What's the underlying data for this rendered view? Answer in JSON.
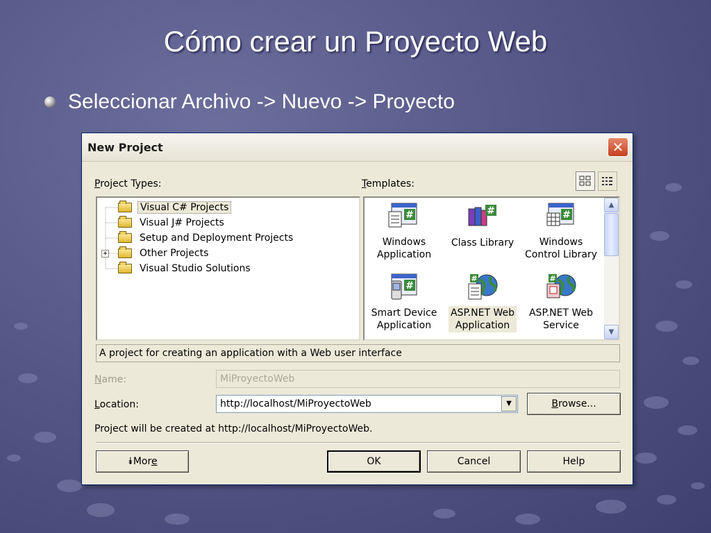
{
  "slide": {
    "title": "Cómo crear un Proyecto Web",
    "bullet": "Seleccionar Archivo -> Nuevo -> Proyecto"
  },
  "dialog": {
    "title": "New Project",
    "close_glyph": "✕",
    "project_types_label": "Project Types:",
    "templates_label": "Templates:",
    "project_types": [
      {
        "label": "Visual C# Projects",
        "selected": true,
        "icon": "folder-open-icon"
      },
      {
        "label": "Visual J# Projects",
        "selected": false,
        "icon": "folder-icon"
      },
      {
        "label": "Setup and Deployment Projects",
        "selected": false,
        "icon": "folder-icon"
      },
      {
        "label": "Other Projects",
        "selected": false,
        "icon": "folder-icon",
        "expander": "+"
      },
      {
        "label": "Visual Studio Solutions",
        "selected": false,
        "icon": "folder-icon"
      }
    ],
    "templates": [
      {
        "line1": "Windows",
        "line2": "Application",
        "icon": "windows-app-icon"
      },
      {
        "line1": "Class Library",
        "line2": "",
        "icon": "class-library-icon"
      },
      {
        "line1": "Windows",
        "line2": "Control Library",
        "icon": "control-library-icon"
      },
      {
        "line1": "Smart Device",
        "line2": "Application",
        "icon": "smart-device-icon"
      },
      {
        "line1": "ASP.NET Web",
        "line2": "Application",
        "icon": "aspnet-web-app-icon",
        "selected": true
      },
      {
        "line1": "ASP.NET Web",
        "line2": "Service",
        "icon": "aspnet-web-service-icon"
      }
    ],
    "description": "A project for creating an application with a Web user interface",
    "name_label": "Name:",
    "name_value": "MiProyectoWeb",
    "location_label": "Location:",
    "location_value": "http://localhost/MiProyectoWeb",
    "browse_label": "Browse...",
    "created_at_text": "Project will be created at http://localhost/MiProyectoWeb.",
    "more_label": "More",
    "ok_label": "OK",
    "cancel_label": "Cancel",
    "help_label": "Help"
  },
  "colors": {
    "accent": "#0a246a",
    "dialog_bg": "#ece9d8",
    "close_red": "#c4411f"
  }
}
